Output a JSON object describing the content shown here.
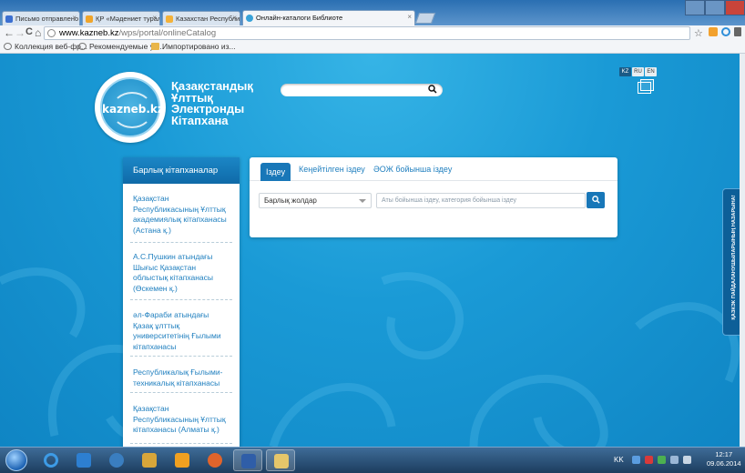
{
  "browser": {
    "tabs": [
      {
        "title": "Письмо отправлено - das",
        "fav_color": "#3b6fd1"
      },
      {
        "title": "ҚР «Мәдениет туралы» За",
        "fav_color": "#f0a52a"
      },
      {
        "title": "Казахстан Республикасын",
        "fav_color": "#f4b23a"
      },
      {
        "title": "Онлайн-каталоги Библиоте",
        "fav_color": "#39a2d8"
      }
    ],
    "tab_close": "×",
    "address": {
      "host": "www.kazneb.kz",
      "path": "/wps/portal/onlineCatalog"
    },
    "bookmarks": [
      {
        "label": "Коллекция веб-фр...",
        "color": "#777"
      },
      {
        "label": "Рекомендуемые уз...",
        "color": "#777"
      },
      {
        "label": "Импортировано из...",
        "color": "#e9b64a"
      }
    ],
    "nav": {
      "back": "←",
      "forward": "→",
      "reload": "C",
      "home": "⌂",
      "star": "☆"
    }
  },
  "header": {
    "logo_text": "kazneb.kz",
    "brand_lines": [
      "Қазақстандық",
      "Ұлттық",
      "Электронды",
      "Кітапхана"
    ],
    "search_icon": "search-icon",
    "languages": [
      {
        "code": "KZ",
        "active": true
      },
      {
        "code": "RU",
        "active": false
      },
      {
        "code": "EN",
        "active": false
      }
    ]
  },
  "sidebar": {
    "all_label": "Барлық кітапханалар",
    "items": [
      {
        "label": "Қазақстан Республикасының Ұлттық академиялық кітапханасы (Астана қ.)"
      },
      {
        "label": "А.С.Пушкин атындағы Шығыс Қазақстан облыстық кітапханасы (Өскемен қ.)"
      },
      {
        "label": "әл-Фараби атындағы Қазақ ұлттық университетінің Ғылыми кітапханасы"
      },
      {
        "label": "Республикалық Ғылыми-техникалық кітапханасы"
      },
      {
        "label": "Қазақстан Республикасының Ұлттық кітапханасы (Алматы қ.)"
      }
    ]
  },
  "search": {
    "tabs": [
      "Іздеу",
      "Кеңейтілген іздеу",
      "ӘОЖ бойынша іздеу"
    ],
    "category_value": "Барлық жолдар",
    "query_placeholder": "Аты бойынша іздеу, категория бойынша іздеу",
    "button_icon": "search-icon"
  },
  "feedback": {
    "label": "ҚАЗКЭК ПАЙДАЛАНУШЫЛАРЫНЫҢ НАЗАРЫНА!"
  },
  "taskbar": {
    "tray_lang": "KK",
    "time": "12:17",
    "date": "09.06.2014"
  },
  "colors": {
    "accent": "#1877b8",
    "link": "#1f7fbf",
    "page_bg": "#1a9ad6"
  }
}
